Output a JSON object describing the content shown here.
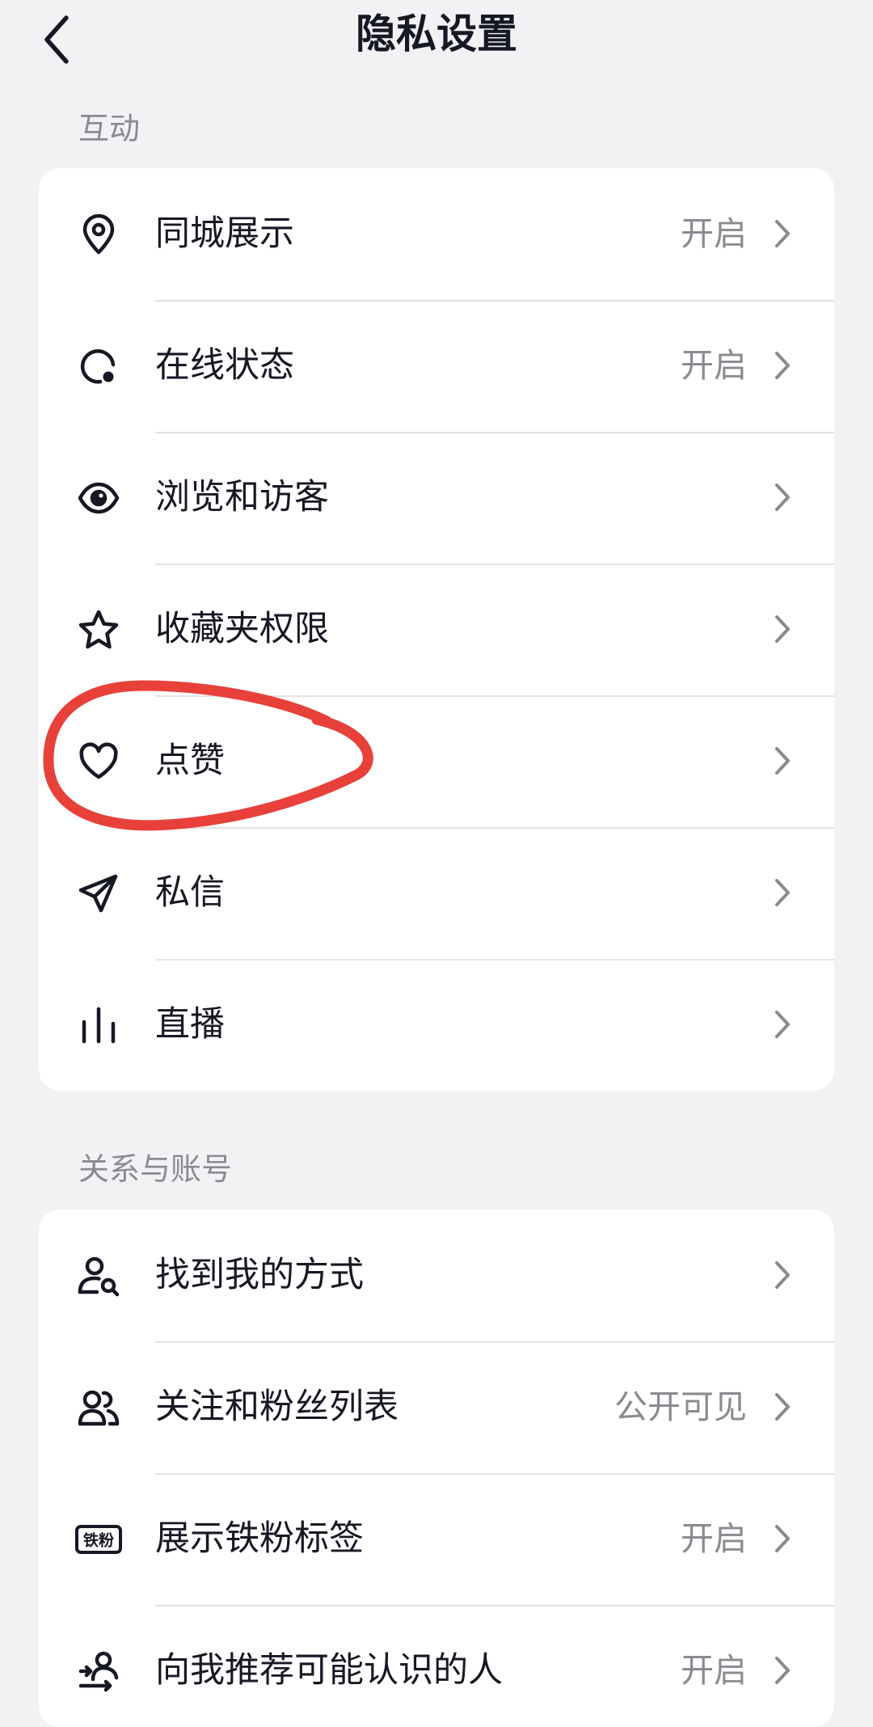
{
  "header": {
    "title": "隐私设置"
  },
  "sections": [
    {
      "title": "互动",
      "items": [
        {
          "label": "同城展示",
          "value": "开启",
          "icon": "location-pin-icon"
        },
        {
          "label": "在线状态",
          "value": "开启",
          "icon": "online-status-icon"
        },
        {
          "label": "浏览和访客",
          "value": "",
          "icon": "eye-icon"
        },
        {
          "label": "收藏夹权限",
          "value": "",
          "icon": "star-icon"
        },
        {
          "label": "点赞",
          "value": "",
          "icon": "heart-icon"
        },
        {
          "label": "私信",
          "value": "",
          "icon": "paper-plane-icon"
        },
        {
          "label": "直播",
          "value": "",
          "icon": "live-bars-icon"
        }
      ]
    },
    {
      "title": "关系与账号",
      "items": [
        {
          "label": "找到我的方式",
          "value": "",
          "icon": "user-search-icon"
        },
        {
          "label": "关注和粉丝列表",
          "value": "公开可见",
          "icon": "users-icon"
        },
        {
          "label": "展示铁粉标签",
          "value": "开启",
          "icon": "iron-fan-badge-icon",
          "badge_text": "铁粉"
        },
        {
          "label": "向我推荐可能认识的人",
          "value": "开启",
          "icon": "recommend-people-icon"
        }
      ]
    }
  ],
  "annotation": {
    "color": "#e8413a",
    "target": "点赞"
  }
}
